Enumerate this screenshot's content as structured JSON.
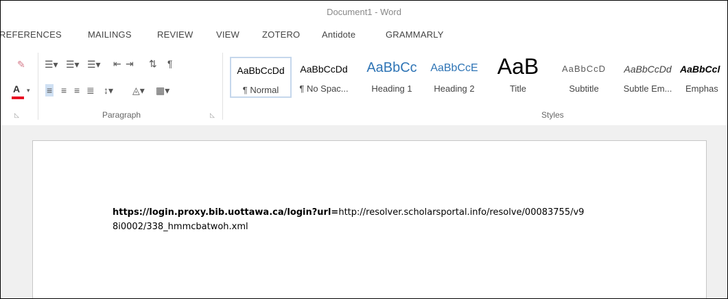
{
  "window": {
    "title": "Document1 - Word"
  },
  "tabs": [
    "REFERENCES",
    "MAILINGS",
    "REVIEW",
    "VIEW",
    "ZOTERO",
    "Antidote",
    "GRAMMARLY"
  ],
  "ribbon": {
    "paragraph_label": "Paragraph",
    "styles_label": "Styles",
    "styles": [
      {
        "preview": "AaBbCcDd",
        "name": "¶ Normal"
      },
      {
        "preview": "AaBbCcDd",
        "name": "¶ No Spac..."
      },
      {
        "preview": "AaBbCc",
        "name": "Heading 1"
      },
      {
        "preview": "AaBbCcE",
        "name": "Heading 2"
      },
      {
        "preview": "AaB",
        "name": "Title"
      },
      {
        "preview": "AaBbCcD",
        "name": "Subtitle"
      },
      {
        "preview": "AaBbCcDd",
        "name": "Subtle Em..."
      },
      {
        "preview": "AaBbCcl",
        "name": "Emphas"
      }
    ]
  },
  "document": {
    "line1_bold": "https://login.proxy.bib.uottawa.ca/login?url=",
    "line1_rest": "http://resolver.scholarsportal.info/resolve/00083755/v9",
    "line2": "8i0002/338_hmmcbatwoh.xml"
  },
  "colors": {
    "font_color_underline": "#e81123",
    "selected_style_border": "#c5d7ec",
    "heading_blue": "#2e74b5"
  }
}
